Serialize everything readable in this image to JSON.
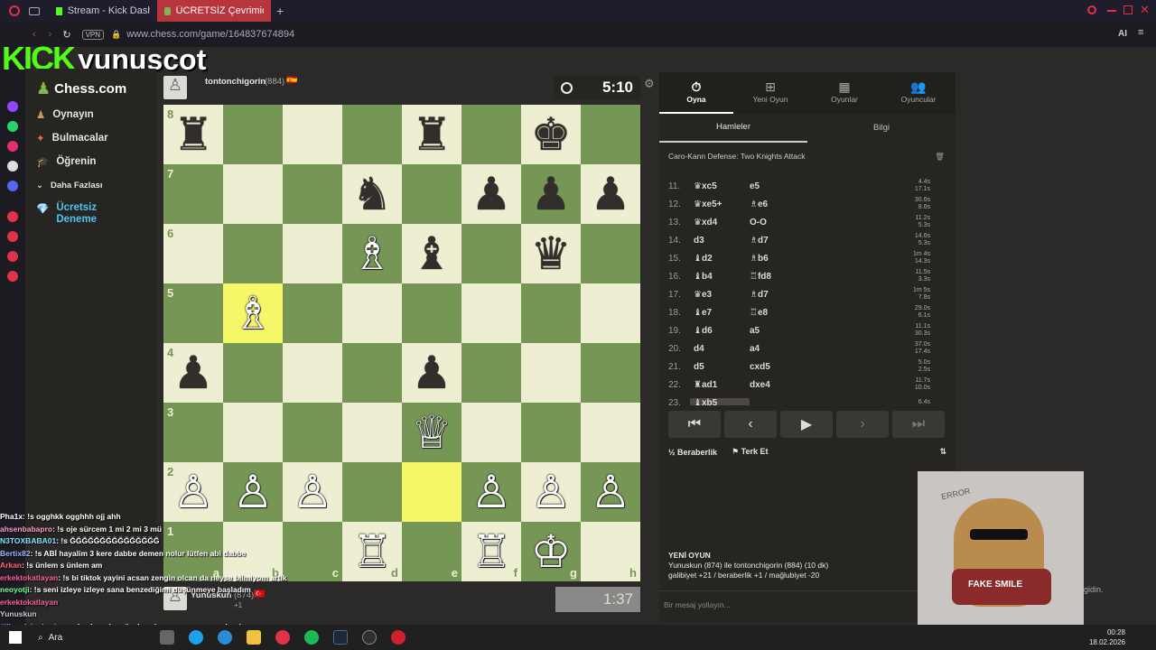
{
  "browser": {
    "tabs": [
      {
        "label": "Stream - Kick Dashboard"
      },
      {
        "label": "ÜCRETSİZ Çevrimiçi Satra"
      }
    ],
    "vpn": "VPN",
    "url": "www.chess.com/game/164837674894",
    "ai": "AI"
  },
  "overlay": {
    "kick": "KICK",
    "channel": "yunuscot"
  },
  "sidebar": {
    "logo": "Chess.com",
    "items": [
      {
        "label": "Oynayın"
      },
      {
        "label": "Bulmacalar"
      },
      {
        "label": "Öğrenin"
      },
      {
        "label": "Daha Fazlası"
      },
      {
        "label": "Ücretsiz Deneme"
      }
    ]
  },
  "top_player": {
    "name": "tontonchigorin",
    "rating": "(884)",
    "flag": "🇪🇸",
    "clock": "5:10"
  },
  "bottom_player": {
    "name": "Yunuskun",
    "rating": "(874)",
    "flag": "🇹🇷",
    "clock": "1:37",
    "captured": "+1"
  },
  "board": {
    "ranks": [
      "8",
      "7",
      "6",
      "5",
      "4",
      "3",
      "2",
      "1"
    ],
    "files": [
      "a",
      "b",
      "c",
      "d",
      "e",
      "f",
      "g",
      "h"
    ],
    "position": [
      [
        "♜",
        "",
        "",
        "",
        "♜",
        "",
        "♚",
        ""
      ],
      [
        "",
        "",
        "",
        "♞",
        "",
        "♟",
        "♟",
        "♟"
      ],
      [
        "",
        "",
        "",
        "♗",
        "♝",
        "",
        "♛",
        ""
      ],
      [
        "",
        "♗",
        "",
        "",
        "",
        "",
        "",
        ""
      ],
      [
        "♟",
        "",
        "",
        "",
        "♟",
        "",
        "",
        ""
      ],
      [
        "",
        "",
        "",
        "",
        "♕",
        "",
        "",
        ""
      ],
      [
        "♙",
        "♙",
        "♙",
        "",
        "",
        "♙",
        "♙",
        "♙"
      ],
      [
        "",
        "",
        "",
        "♖",
        "",
        "♖",
        "♔",
        ""
      ]
    ],
    "highlighted": [
      "b5",
      "e2"
    ],
    "colors": {
      "light": "#eeeed2",
      "dark": "#769656",
      "highlight": "#f6f669"
    }
  },
  "panel": {
    "tabs": [
      {
        "label": "Oyna",
        "icon": "stopwatch-icon"
      },
      {
        "label": "Yeni Oyun",
        "icon": "plus-icon"
      },
      {
        "label": "Oyunlar",
        "icon": "board-icon"
      },
      {
        "label": "Oyuncular",
        "icon": "players-icon"
      }
    ],
    "subtabs": [
      "Hamleler",
      "Bilgi"
    ],
    "opening": "Caro-Kann Defense: Two Knights Attack",
    "moves": [
      {
        "num": "11.",
        "white": "xc5",
        "white_piece": "♛",
        "black": "e5",
        "black_piece": "",
        "t1": "4.4s",
        "t2": "17.1s"
      },
      {
        "num": "12.",
        "white": "xe5+",
        "white_piece": "♛",
        "black": "e6",
        "black_piece": "♗",
        "t1": "30.6s",
        "t2": "8.6s"
      },
      {
        "num": "13.",
        "white": "xd4",
        "white_piece": "♛",
        "black": "O-O",
        "black_piece": "",
        "t1": "11.2s",
        "t2": "5.3s"
      },
      {
        "num": "14.",
        "white": "d3",
        "white_piece": "",
        "black": "d7",
        "black_piece": "♗",
        "t1": "14.6s",
        "t2": "5.3s"
      },
      {
        "num": "15.",
        "white": "d2",
        "white_piece": "♝",
        "black": "b6",
        "black_piece": "♗",
        "t1": "1m 4s",
        "t2": "14.3s"
      },
      {
        "num": "16.",
        "white": "b4",
        "white_piece": "♝",
        "black": "fd8",
        "black_piece": "♖",
        "t1": "11.5s",
        "t2": "3.3s"
      },
      {
        "num": "17.",
        "white": "e3",
        "white_piece": "♛",
        "black": "d7",
        "black_piece": "♗",
        "t1": "1m 5s",
        "t2": "7.8s"
      },
      {
        "num": "18.",
        "white": "e7",
        "white_piece": "♝",
        "black": "e8",
        "black_piece": "♖",
        "t1": "29.0s",
        "t2": "6.1s"
      },
      {
        "num": "19.",
        "white": "d6",
        "white_piece": "♝",
        "black": "a5",
        "black_piece": "",
        "t1": "11.1s",
        "t2": "30.3s"
      },
      {
        "num": "20.",
        "white": "d4",
        "white_piece": "",
        "black": "a4",
        "black_piece": "",
        "t1": "37.0s",
        "t2": "17.4s"
      },
      {
        "num": "21.",
        "white": "d5",
        "white_piece": "",
        "black": "cxd5",
        "black_piece": "",
        "t1": "5.0s",
        "t2": "2.5s"
      },
      {
        "num": "22.",
        "white": "ad1",
        "white_piece": "♜",
        "black": "dxe4",
        "black_piece": "",
        "t1": "11.7s",
        "t2": "10.0s"
      },
      {
        "num": "23.",
        "white": "xb5",
        "white_piece": "♝",
        "black": "",
        "black_piece": "",
        "t1": "6.4s",
        "t2": ""
      }
    ],
    "nav": [
      "⏮",
      "‹",
      "▶",
      "›",
      "⏭"
    ],
    "draw": "Beraberlik",
    "resign": "Terk Et",
    "new_game_title": "YENİ OYUN",
    "new_game_desc": "Yunuskun (874) ile tontonchigorin (884) (10 dk)",
    "new_game_stats": "galibiyet +21 / beraberlik +1 / mağlubiyet -20",
    "chat_placeholder": "Bir mesaj yollayın..."
  },
  "webcam": {
    "error": "ERROR",
    "shirt": "FAKE SMILE",
    "side": "gidin."
  },
  "chat": [
    {
      "user": "Pha1x",
      "color": "#ffffff",
      "msg": ": !s ogghkk ogghhh ojj ahh"
    },
    {
      "user": "ahsenbabapro",
      "color": "#ff9dd0",
      "msg": ": !s oje sürcem 1 mi 2 mi 3 mü"
    },
    {
      "user": "N3TOXBABA01",
      "color": "#7ee7ff",
      "msg": ": !s ĞĞĞĞĞĞĞĞĞĞĞĞĞĞĞ"
    },
    {
      "user": "Bertix82",
      "color": "#9ab8ff",
      "msg": ": !s ABİ hayalim 3 kere dabbe demen nolur lütfen abi dabbe"
    },
    {
      "user": "Arkan",
      "color": "#ff6b6b",
      "msg": ": !s ünlem s ünlem am"
    },
    {
      "user": "erkektokatlayan",
      "color": "#ff5fa2",
      "msg": ": !s bi tiktok yayini acsan zengin olcan da neyse bilmiyom artik"
    },
    {
      "user": "neoyotji",
      "color": "#7cff9b",
      "msg": ": !s seni izleye izleye sana benzediğimi düşünmeye başladım"
    },
    {
      "user": "erkektokatlayan",
      "color": "#ff5fa2",
      "msg": ""
    },
    {
      "user": "Yunuskun",
      "color": "#cccccc",
      "msg": ""
    },
    {
      "user": "#illanolakedurduraa",
      "color": "#c98bff",
      "msg": ": !s abonelere özel ayak şov yapar mısın alrsak"
    }
  ],
  "taskbar": {
    "search": "Ara",
    "time": "00:28",
    "date": "18.02.2026"
  }
}
